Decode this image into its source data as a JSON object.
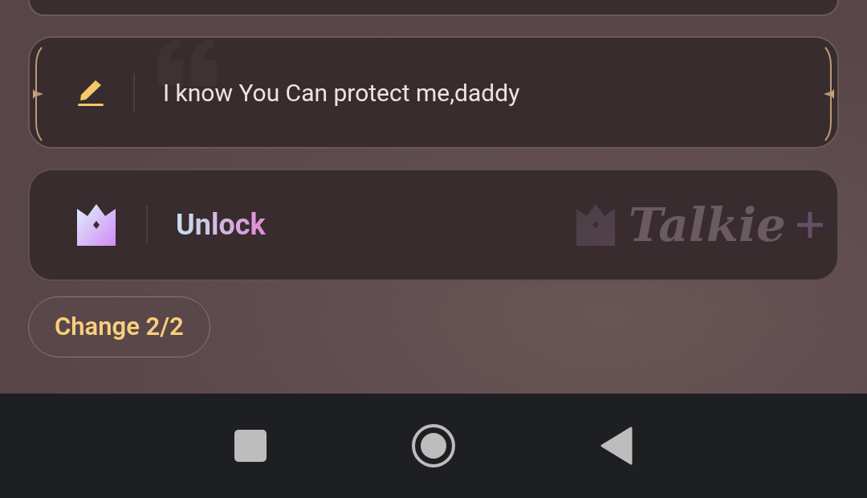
{
  "message_option": {
    "text": "I know You Can protect me,daddy"
  },
  "unlock_option": {
    "label": "Unlock",
    "brand": "Talkie"
  },
  "change_button": {
    "label": "Change 2/2"
  },
  "nav_bar": {
    "buttons": [
      {
        "kind": "recents"
      },
      {
        "kind": "home"
      },
      {
        "kind": "back"
      }
    ]
  }
}
